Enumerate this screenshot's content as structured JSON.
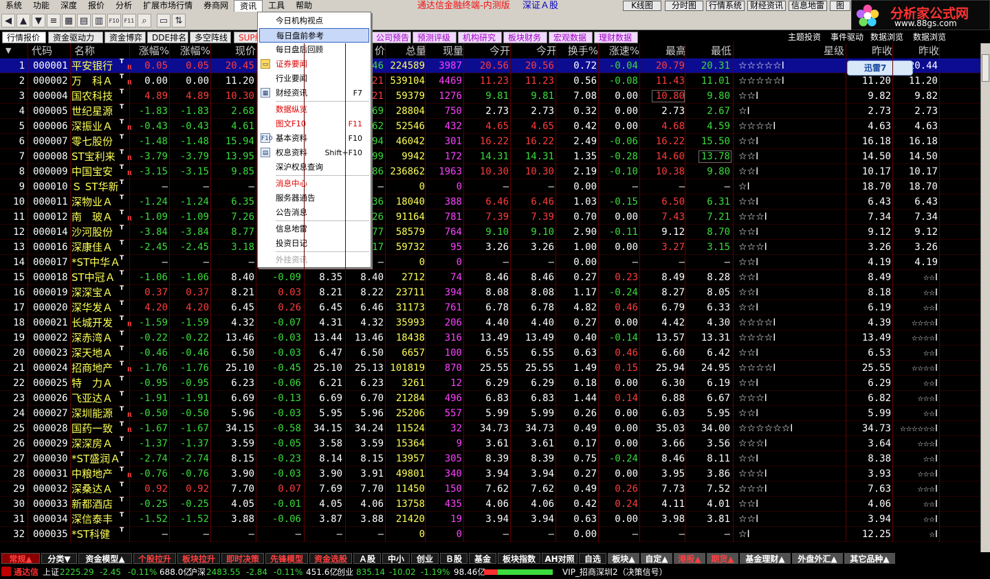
{
  "menu": [
    "系统",
    "功能",
    "深度",
    "报价",
    "分析",
    "扩展市场行情",
    "券商网",
    "资讯",
    "工具",
    "帮助"
  ],
  "app_title": "通达信金融终端-内测版",
  "market_label": "深证Ａ股",
  "top_buttons": [
    "K线图",
    "分时图",
    "行情系统",
    "财经资讯",
    "信息地雷",
    "图"
  ],
  "watermark": {
    "title": "分析家公式网",
    "url": "www.88gs.com"
  },
  "thunder": "迅雷7",
  "tabs_left": [
    "行情报价",
    "资金驱动力",
    "资金博弈",
    "DDE排名",
    "多空阵线",
    "SUP级"
  ],
  "tabs_mid": [
    "公司预告",
    "预测评级",
    "机构研究",
    "板块财务",
    "宏观数据",
    "理财数据"
  ],
  "tabs_right": [
    "主题投资",
    "事件驱动",
    "数据浏览",
    "数据浏览"
  ],
  "columns": [
    "代码",
    "名称",
    "涨幅%",
    "涨幅%",
    "现价",
    "价",
    "总量",
    "现量",
    "今开",
    "今开",
    "换手%",
    "涨速%",
    "最高",
    "最低",
    "星级",
    "昨收",
    "昨收"
  ],
  "rows": [
    [
      "1",
      "000001",
      "平安银行",
      "0.05",
      "0.05",
      "20.45",
      "",
      "0.46",
      "224589",
      "3987",
      "20.56",
      "20.56",
      "0.72",
      "-0.04",
      "20.79",
      "20.31",
      "☆☆☆☆☆Ⅰ",
      "20.44",
      "20.44"
    ],
    [
      "2",
      "000002",
      "万　科Ａ",
      "0.00",
      "0.00",
      "11.20",
      "",
      "11.21",
      "539104",
      "4469",
      "11.23",
      "11.23",
      "0.56",
      "-0.08",
      "11.43",
      "11.01",
      "☆☆☆☆☆Ⅰ",
      "11.20",
      "11.20"
    ],
    [
      "3",
      "000004",
      "国农科技",
      "4.89",
      "4.89",
      "10.30",
      "",
      "10.21",
      "59379",
      "1276",
      "9.81",
      "9.81",
      "7.08",
      "0.00",
      "10.80",
      "9.80",
      "☆☆Ⅰ",
      "9.82",
      "9.82"
    ],
    [
      "4",
      "000005",
      "世纪星源",
      "-1.83",
      "-1.83",
      "2.68",
      "",
      "2.69",
      "28804",
      "750",
      "2.73",
      "2.73",
      "0.32",
      "0.00",
      "2.73",
      "2.67",
      "☆Ⅰ",
      "2.73",
      "2.73"
    ],
    [
      "5",
      "000006",
      "深振业Ａ",
      "-0.43",
      "-0.43",
      "4.61",
      "",
      "4.62",
      "52546",
      "432",
      "4.65",
      "4.65",
      "0.42",
      "0.00",
      "4.68",
      "4.59",
      "☆☆☆☆Ⅰ",
      "4.63",
      "4.63"
    ],
    [
      "6",
      "000007",
      "零七股份",
      "-1.48",
      "-1.48",
      "15.94",
      "",
      "15.94",
      "46042",
      "301",
      "16.22",
      "16.22",
      "2.49",
      "-0.06",
      "16.22",
      "15.50",
      "☆☆Ⅰ",
      "16.18",
      "16.18"
    ],
    [
      "7",
      "000008",
      "ST宝利来",
      "-3.79",
      "-3.79",
      "13.95",
      "",
      "13.99",
      "9942",
      "172",
      "14.31",
      "14.31",
      "1.35",
      "-0.28",
      "14.60",
      "13.78",
      "☆☆Ⅰ",
      "14.50",
      "14.50"
    ],
    [
      "8",
      "000009",
      "中国宝安",
      "-3.15",
      "-3.15",
      "9.85",
      "",
      "9.86",
      "236862",
      "1963",
      "10.30",
      "10.30",
      "2.19",
      "-0.10",
      "10.38",
      "9.80",
      "☆☆Ⅰ",
      "10.17",
      "10.17"
    ],
    [
      "9",
      "000010",
      "Ｓ ST华新",
      "—",
      "—",
      "—",
      "",
      "—",
      "0",
      "0",
      "—",
      "—",
      "0.00",
      "—",
      "—",
      "—",
      "☆Ⅰ",
      "18.70",
      "18.70"
    ],
    [
      "10",
      "000011",
      "深物业Ａ",
      "-1.24",
      "-1.24",
      "6.35",
      "",
      "6.36",
      "18040",
      "388",
      "6.46",
      "6.46",
      "1.03",
      "-0.15",
      "6.50",
      "6.31",
      "☆☆Ⅰ",
      "6.43",
      "6.43"
    ],
    [
      "11",
      "000012",
      "南　玻Ａ",
      "-1.09",
      "-1.09",
      "7.26",
      "",
      "7.26",
      "91164",
      "781",
      "7.39",
      "7.39",
      "0.70",
      "0.00",
      "7.43",
      "7.21",
      "☆☆☆Ⅰ",
      "7.34",
      "7.34"
    ],
    [
      "12",
      "000014",
      "沙河股份",
      "-3.84",
      "-3.84",
      "8.77",
      "",
      "8.77",
      "58579",
      "764",
      "9.10",
      "9.10",
      "2.90",
      "-0.11",
      "9.12",
      "8.70",
      "☆☆Ⅰ",
      "9.12",
      "9.12"
    ],
    [
      "13",
      "000016",
      "深康佳Ａ",
      "-2.45",
      "-2.45",
      "3.18",
      "",
      "3.17",
      "59732",
      "95",
      "3.26",
      "3.26",
      "1.00",
      "0.00",
      "3.27",
      "3.15",
      "☆☆☆Ⅰ",
      "3.26",
      "3.26"
    ],
    [
      "14",
      "000017",
      "*ST中华Ａ",
      "—",
      "—",
      "—",
      "",
      "—",
      "0",
      "0",
      "—",
      "—",
      "0.00",
      "—",
      "—",
      "—",
      "☆☆Ⅰ",
      "4.19",
      "4.19"
    ],
    [
      "15",
      "000018",
      "ST中冠Ａ",
      "-1.06",
      "-1.06",
      "8.40",
      "-0.09",
      "8.35",
      "8.40",
      "2712",
      "74",
      "8.46",
      "8.46",
      "0.27",
      "0.23",
      "8.49",
      "8.28",
      "☆☆Ⅰ",
      "8.49",
      "8.49"
    ],
    [
      "16",
      "000019",
      "深深宝Ａ",
      "0.37",
      "0.37",
      "8.21",
      "0.03",
      "8.21",
      "8.22",
      "23711",
      "394",
      "8.08",
      "8.08",
      "1.17",
      "-0.24",
      "8.27",
      "8.05",
      "☆☆Ⅰ",
      "8.18",
      "8.18"
    ],
    [
      "17",
      "000020",
      "深华发Ａ",
      "4.20",
      "4.20",
      "6.45",
      "0.26",
      "6.45",
      "6.46",
      "31173",
      "761",
      "6.78",
      "6.78",
      "4.82",
      "0.46",
      "6.79",
      "6.33",
      "☆☆Ⅰ",
      "6.19",
      "6.19"
    ],
    [
      "18",
      "000021",
      "长城开发",
      "-1.59",
      "-1.59",
      "4.32",
      "-0.07",
      "4.31",
      "4.32",
      "35993",
      "206",
      "4.40",
      "4.40",
      "0.27",
      "0.00",
      "4.42",
      "4.30",
      "☆☆☆☆Ⅰ",
      "4.39",
      "4.39"
    ],
    [
      "19",
      "000022",
      "深赤湾Ａ",
      "-0.22",
      "-0.22",
      "13.46",
      "-0.03",
      "13.44",
      "13.46",
      "18438",
      "316",
      "13.49",
      "13.49",
      "0.40",
      "-0.14",
      "13.57",
      "13.31",
      "☆☆☆☆Ⅰ",
      "13.49",
      "13.49"
    ],
    [
      "20",
      "000023",
      "深天地Ａ",
      "-0.46",
      "-0.46",
      "6.50",
      "-0.03",
      "6.47",
      "6.50",
      "6657",
      "100",
      "6.55",
      "6.55",
      "0.63",
      "0.46",
      "6.60",
      "6.42",
      "☆☆Ⅰ",
      "6.53",
      "6.53"
    ],
    [
      "21",
      "000024",
      "招商地产",
      "-1.76",
      "-1.76",
      "25.10",
      "-0.45",
      "25.10",
      "25.13",
      "101819",
      "870",
      "25.55",
      "25.55",
      "1.49",
      "0.15",
      "25.94",
      "24.95",
      "☆☆☆☆Ⅰ",
      "25.55",
      "25.55"
    ],
    [
      "22",
      "000025",
      "特　力Ａ",
      "-0.95",
      "-0.95",
      "6.23",
      "-0.06",
      "6.21",
      "6.23",
      "3261",
      "12",
      "6.29",
      "6.29",
      "0.18",
      "0.00",
      "6.30",
      "6.19",
      "☆☆Ⅰ",
      "6.29",
      "6.29"
    ],
    [
      "23",
      "000026",
      "飞亚达Ａ",
      "-1.91",
      "-1.91",
      "6.69",
      "-0.13",
      "6.69",
      "6.70",
      "21284",
      "496",
      "6.83",
      "6.83",
      "1.44",
      "0.14",
      "6.88",
      "6.67",
      "☆☆☆Ⅰ",
      "6.82",
      "6.82"
    ],
    [
      "24",
      "000027",
      "深圳能源",
      "-0.50",
      "-0.50",
      "5.96",
      "-0.03",
      "5.95",
      "5.96",
      "25206",
      "557",
      "5.99",
      "5.99",
      "0.26",
      "0.00",
      "6.03",
      "5.95",
      "☆☆Ⅰ",
      "5.99",
      "5.99"
    ],
    [
      "25",
      "000028",
      "国药一致",
      "-1.67",
      "-1.67",
      "34.15",
      "-0.58",
      "34.15",
      "34.24",
      "11524",
      "32",
      "34.73",
      "34.73",
      "0.49",
      "0.00",
      "35.03",
      "34.00",
      "☆☆☆☆☆☆Ⅰ",
      "34.73",
      "34.73"
    ],
    [
      "26",
      "000029",
      "深深房Ａ",
      "-1.37",
      "-1.37",
      "3.59",
      "-0.05",
      "3.58",
      "3.59",
      "15364",
      "9",
      "3.61",
      "3.61",
      "0.17",
      "0.00",
      "3.66",
      "3.56",
      "☆☆☆Ⅰ",
      "3.64",
      "3.64"
    ],
    [
      "27",
      "000030",
      "*ST盛润Ａ",
      "-2.74",
      "-2.74",
      "8.15",
      "-0.23",
      "8.14",
      "8.15",
      "13957",
      "305",
      "8.39",
      "8.39",
      "0.75",
      "-0.24",
      "8.46",
      "8.11",
      "☆☆Ⅰ",
      "8.38",
      "8.38"
    ],
    [
      "28",
      "000031",
      "中粮地产",
      "-0.76",
      "-0.76",
      "3.90",
      "-0.03",
      "3.90",
      "3.91",
      "49801",
      "340",
      "3.94",
      "3.94",
      "0.27",
      "0.00",
      "3.95",
      "3.86",
      "☆☆☆Ⅰ",
      "3.93",
      "3.93"
    ],
    [
      "29",
      "000032",
      "深桑达Ａ",
      "0.92",
      "0.92",
      "7.70",
      "0.07",
      "7.69",
      "7.70",
      "11450",
      "150",
      "7.62",
      "7.62",
      "0.49",
      "0.26",
      "7.73",
      "7.52",
      "☆☆☆Ⅰ",
      "7.63",
      "7.63"
    ],
    [
      "30",
      "000033",
      "新都酒店",
      "-0.25",
      "-0.25",
      "4.05",
      "-0.01",
      "4.05",
      "4.06",
      "13758",
      "435",
      "4.06",
      "4.06",
      "0.42",
      "0.24",
      "4.11",
      "4.01",
      "☆☆Ⅰ",
      "4.06",
      "4.06"
    ],
    [
      "31",
      "000034",
      "深信泰丰",
      "-1.52",
      "-1.52",
      "3.88",
      "-0.06",
      "3.87",
      "3.88",
      "21420",
      "19",
      "3.94",
      "3.94",
      "0.63",
      "0.00",
      "3.98",
      "3.81",
      "☆☆Ⅰ",
      "3.94",
      "3.94"
    ],
    [
      "32",
      "000035",
      "*ST科健",
      "—",
      "—",
      "—",
      "—",
      "—",
      "—",
      "0",
      "0",
      "—",
      "—",
      "0.00",
      "—",
      "—",
      "—",
      "☆Ⅰ",
      "12.25",
      "12.25"
    ]
  ],
  "dropdown": [
    {
      "label": "今日机构视点",
      "color": "#000000"
    },
    {
      "label": "每日盘前参考",
      "color": "#000000",
      "highlight": true
    },
    {
      "label": "每日盘后回顾",
      "color": "#000000"
    },
    {
      "label": "证券要闻",
      "color": "#e00000",
      "icon": "folder"
    },
    {
      "label": "行业要闻",
      "color": "#000000"
    },
    {
      "label": "财经资讯",
      "color": "#000000",
      "icon": "grid",
      "shortcut": "F7"
    },
    {
      "label": "数据纵览",
      "color": "#e00000",
      "sep": true
    },
    {
      "label": "图文F10",
      "color": "#e00000",
      "shortcut": "F11"
    },
    {
      "label": "基本资料",
      "color": "#000000",
      "icon": "F10",
      "shortcut": "F10"
    },
    {
      "label": "权息资料",
      "color": "#000000",
      "icon": "doc",
      "shortcut": "Shift+F10"
    },
    {
      "label": "深沪权息查询",
      "color": "#000000"
    },
    {
      "label": "消息中心",
      "color": "#e00000",
      "sep": true
    },
    {
      "label": "服务器通告",
      "color": "#000000"
    },
    {
      "label": "公告消息",
      "color": "#000000"
    },
    {
      "label": "信息地雷",
      "color": "#000000",
      "sep": true
    },
    {
      "label": "投资日记",
      "color": "#000000"
    },
    {
      "label": "外挂资讯",
      "color": "#a0a0a0",
      "sep": true
    }
  ],
  "bottom_tabs": [
    "常规▲",
    "分类▼",
    "资金模型▲",
    "个股拉升",
    "板块拉升",
    "即时决策",
    "先锋模型",
    "资金选股",
    "Ａ股",
    "中小",
    "创业",
    "Ｂ股",
    "基金",
    "板块指数",
    "AH对照",
    "自选",
    "板块▲",
    "自定▲",
    "港股▲",
    "期货▲",
    "基金理财▲",
    "外盘外汇▲",
    "其它品种▲"
  ],
  "status": {
    "brand": "通达信",
    "sh_label": "上证",
    "sh_val": "2225.29",
    "sh_chg": "-2.45",
    "sh_pct": "-0.11%",
    "sh_amt": "688.0亿",
    "sz_label": "沪深",
    "sz_val": "2483.55",
    "sz_chg": "-2.84",
    "sz_pct": "-0.11%",
    "sz_amt": "451.6亿",
    "cy_label": "创业",
    "cy_val": "835.14",
    "cy_chg": "-10.02",
    "cy_pct": "-1.19%",
    "cy_amt": "98.46亿",
    "vip": "VIP_招商深圳2（决策信号）"
  },
  "colors": {
    "up": "#ff3c3c",
    "down": "#3cdc3c",
    "flat": "#ffffff",
    "code": "#ffffff",
    "name": "#ffff55",
    "volume": "#ffff55",
    "curvol": "#ff40ff",
    "menu_bg": "#d4d0c8"
  }
}
